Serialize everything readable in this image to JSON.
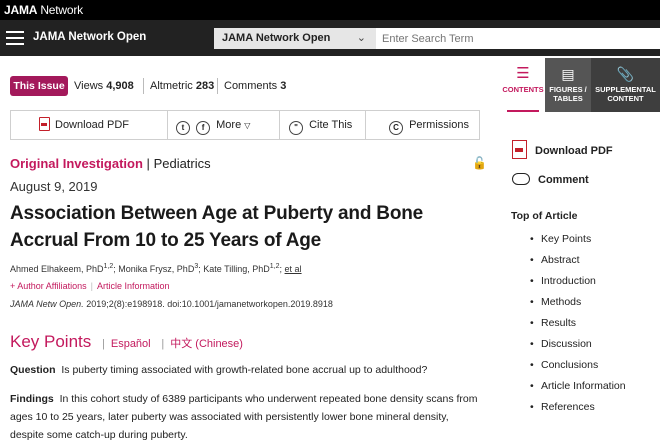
{
  "topbar": {
    "brand_bold": "JAMA",
    "brand_rest": "Network"
  },
  "header": {
    "journal_name": "JAMA Network Open",
    "journal_select": "JAMA Network Open",
    "search_placeholder": "Enter Search Term"
  },
  "stats": {
    "this_issue": "This Issue",
    "views_label": "Views",
    "views_value": "4,908",
    "altmetric_label": "Altmetric",
    "altmetric_value": "283",
    "comments_label": "Comments",
    "comments_value": "3"
  },
  "toolbar": {
    "download_pdf": "Download PDF",
    "more": "More",
    "cite_this": "Cite This",
    "permissions": "Permissions"
  },
  "article": {
    "type": "Original Investigation",
    "separator": "|",
    "category": "Pediatrics",
    "date": "August 9, 2019",
    "title": "Association Between Age at Puberty and Bone Accrual From 10 to 25 Years of Age",
    "authors": [
      {
        "name": "Ahmed Elhakeem, PhD",
        "sup": "1,2"
      },
      {
        "name": "Monika Frysz, PhD",
        "sup": "3"
      },
      {
        "name": "Kate Tilling, PhD",
        "sup": "1,2"
      }
    ],
    "et_al": "et al",
    "author_affiliations": "Author Affiliations",
    "article_information": "Article Information",
    "citation_journal": "JAMA Netw Open.",
    "citation_rest": " 2019;2(8):e198918. doi:10.1001/jamanetworkopen.2019.8918"
  },
  "key_points": {
    "heading": "Key Points",
    "lang_es": "Español",
    "lang_zh": "中文 (Chinese)",
    "question_label": "Question",
    "question_text": "Is puberty timing associated with growth-related bone accrual up to adulthood?",
    "findings_label": "Findings",
    "findings_text": "In this cohort study of 6389 participants who underwent repeated bone density scans from ages 10 to 25 years, later puberty was associated with persistently lower bone mineral density, despite some catch-up during puberty."
  },
  "sidebar": {
    "tabs": {
      "contents": "CONTENTS",
      "figures_1": "FIGURES /",
      "figures_2": "TABLES",
      "supp_1": "SUPPLEMENTAL",
      "supp_2": "CONTENT"
    },
    "download_pdf": "Download PDF",
    "comment": "Comment",
    "toc_title": "Top of Article",
    "toc_items": [
      "Key Points",
      "Abstract",
      "Introduction",
      "Methods",
      "Results",
      "Discussion",
      "Conclusions",
      "Article Information",
      "References"
    ]
  },
  "colors": {
    "accent": "#c3195d",
    "this_issue_bg": "#a3195b",
    "header_bg": "#222222",
    "pdf_red": "#c3202a"
  }
}
